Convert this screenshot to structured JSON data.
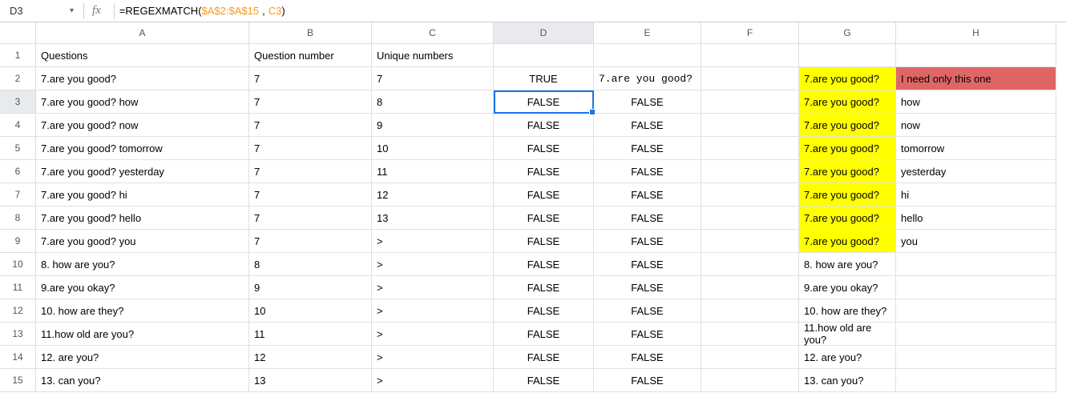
{
  "name_box": "D3",
  "formula": {
    "fn": "=REGEXMATCH",
    "open": "(",
    "range": "$A$2:$A$15",
    "comma": ",",
    "ref": "C3",
    "close": ")"
  },
  "columns": [
    "A",
    "B",
    "C",
    "D",
    "E",
    "F",
    "G",
    "H"
  ],
  "row_numbers": [
    "1",
    "2",
    "3",
    "4",
    "5",
    "6",
    "7",
    "8",
    "9",
    "10",
    "11",
    "12",
    "13",
    "14",
    "15"
  ],
  "headers": {
    "A": "Questions",
    "B": "Question number",
    "C": "Unique numbers",
    "D": "",
    "E": "",
    "F": "",
    "G": "",
    "H": ""
  },
  "rows": [
    {
      "A": "7.are you good?",
      "B": "7",
      "C": "7",
      "D": "TRUE",
      "E": "7.are you good?",
      "G": "7.are you good?",
      "H": "I need only this one",
      "g_hl": "yellow",
      "h_hl": "red",
      "e_mono": true
    },
    {
      "A": "7.are you good? how",
      "B": "7",
      "C": "8",
      "D": "FALSE",
      "E": "FALSE",
      "G": "7.are you good?",
      "H": "how",
      "g_hl": "yellow",
      "active": true
    },
    {
      "A": "7.are you good? now",
      "B": "7",
      "C": "9",
      "D": "FALSE",
      "E": "FALSE",
      "G": "7.are you good?",
      "H": "now",
      "g_hl": "yellow"
    },
    {
      "A": "7.are you good? tomorrow",
      "B": "7",
      "C": "10",
      "D": "FALSE",
      "E": "FALSE",
      "G": "7.are you good?",
      "H": "tomorrow",
      "g_hl": "yellow"
    },
    {
      "A": "7.are you good? yesterday",
      "B": "7",
      "C": "11",
      "D": "FALSE",
      "E": "FALSE",
      "G": "7.are you good?",
      "H": "yesterday",
      "g_hl": "yellow"
    },
    {
      "A": "7.are you good? hi",
      "B": "7",
      "C": "12",
      "D": "FALSE",
      "E": "FALSE",
      "G": "7.are you good?",
      "H": "hi",
      "g_hl": "yellow"
    },
    {
      "A": "7.are you good? hello",
      "B": "7",
      "C": "13",
      "D": "FALSE",
      "E": "FALSE",
      "G": "7.are you good?",
      "H": "hello",
      "g_hl": "yellow"
    },
    {
      "A": "7.are you good? you",
      "B": "7",
      "C": ">",
      "D": "FALSE",
      "E": "FALSE",
      "G": "7.are you good?",
      "H": "you",
      "g_hl": "yellow"
    },
    {
      "A": "8. how are you?",
      "B": "8",
      "C": ">",
      "D": "FALSE",
      "E": "FALSE",
      "G": "8. how are you?",
      "H": ""
    },
    {
      "A": "9.are you okay?",
      "B": "9",
      "C": ">",
      "D": "FALSE",
      "E": "FALSE",
      "G": "9.are you okay?",
      "H": ""
    },
    {
      "A": "10. how are they?",
      "B": "10",
      "C": ">",
      "D": "FALSE",
      "E": "FALSE",
      "G": "10. how are they?",
      "H": ""
    },
    {
      "A": "11.how old are you?",
      "B": "11",
      "C": ">",
      "D": "FALSE",
      "E": "FALSE",
      "G": "11.how old are you?",
      "H": ""
    },
    {
      "A": "12. are you?",
      "B": "12",
      "C": ">",
      "D": "FALSE",
      "E": "FALSE",
      "G": "12. are you?",
      "H": ""
    },
    {
      "A": "13. can you?",
      "B": "13",
      "C": ">",
      "D": "FALSE",
      "E": "FALSE",
      "G": "13. can you?",
      "H": ""
    }
  ],
  "active_cell": {
    "row": 3,
    "col": "D"
  }
}
